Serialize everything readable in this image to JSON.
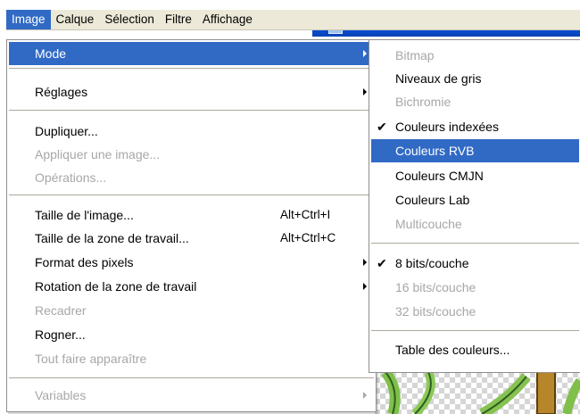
{
  "menubar": {
    "items": [
      "Image",
      "Calque",
      "Sélection",
      "Filtre",
      "Affichage"
    ]
  },
  "menu": {
    "items": [
      {
        "label": "Mode",
        "submenu": true,
        "state": "selected"
      },
      {
        "label": "Réglages",
        "submenu": true,
        "state": "enabled"
      },
      {
        "label": "Dupliquer...",
        "state": "enabled"
      },
      {
        "label": "Appliquer une image...",
        "state": "disabled"
      },
      {
        "label": "Opérations...",
        "state": "disabled"
      },
      {
        "label": "Taille de l'image...",
        "shortcut": "Alt+Ctrl+I",
        "state": "enabled"
      },
      {
        "label": "Taille de la zone de travail...",
        "shortcut": "Alt+Ctrl+C",
        "state": "enabled"
      },
      {
        "label": "Format des pixels",
        "submenu": true,
        "state": "enabled"
      },
      {
        "label": "Rotation de la zone de travail",
        "submenu": true,
        "state": "enabled"
      },
      {
        "label": "Recadrer",
        "state": "disabled"
      },
      {
        "label": "Rogner...",
        "state": "enabled"
      },
      {
        "label": "Tout faire apparaître",
        "state": "disabled"
      },
      {
        "label": "Variables",
        "submenu": true,
        "state": "disabled"
      }
    ]
  },
  "submenu": {
    "items": [
      {
        "label": "Bitmap",
        "state": "disabled"
      },
      {
        "label": "Niveaux de gris",
        "state": "enabled"
      },
      {
        "label": "Bichromie",
        "state": "disabled"
      },
      {
        "label": "Couleurs indexées",
        "state": "enabled",
        "checked": true
      },
      {
        "label": "Couleurs RVB",
        "state": "selected"
      },
      {
        "label": "Couleurs CMJN",
        "state": "enabled"
      },
      {
        "label": "Couleurs Lab",
        "state": "enabled"
      },
      {
        "label": "Multicouche",
        "state": "disabled"
      },
      {
        "label": "8 bits/couche",
        "state": "enabled",
        "checked": true
      },
      {
        "label": "16 bits/couche",
        "state": "disabled"
      },
      {
        "label": "32 bits/couche",
        "state": "disabled"
      },
      {
        "label": "Table des couleurs...",
        "state": "enabled"
      }
    ],
    "check_glyph": "✔"
  },
  "colors": {
    "highlight": "#316ac5",
    "menubar_bg": "#ece9d8",
    "disabled_text": "#a7a7a7",
    "titlebar": "#0a4fd8"
  }
}
